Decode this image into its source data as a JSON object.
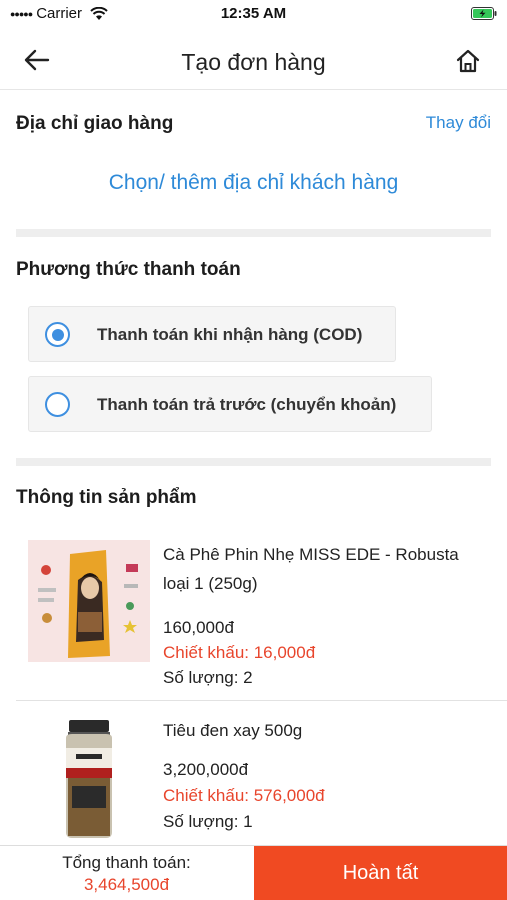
{
  "status_bar": {
    "carrier": "Carrier",
    "time": "12:35 AM"
  },
  "nav": {
    "title": "Tạo đơn hàng",
    "icons": {
      "back": "arrow-left-icon",
      "home": "home-icon"
    }
  },
  "address": {
    "title": "Địa chỉ giao hàng",
    "change_label": "Thay đổi",
    "choose_label": "Chọn/ thêm địa chỉ khách hàng"
  },
  "payment": {
    "title": "Phương thức thanh toán",
    "options": [
      {
        "label": "Thanh toán khi nhận hàng (COD)",
        "selected": true
      },
      {
        "label": "Thanh toán trả trước (chuyển khoản)",
        "selected": false
      }
    ]
  },
  "products": {
    "title": "Thông tin sản phẩm",
    "items": [
      {
        "name": "Cà Phê Phin Nhẹ MISS EDE - Robusta loại 1 (250g)",
        "price": "160,000đ",
        "discount": "Chiết khấu: 16,000đ",
        "quantity": "Số lượng: 2"
      },
      {
        "name": "Tiêu đen xay 500g",
        "price": "3,200,000đ",
        "discount": "Chiết khấu: 576,000đ",
        "quantity": "Số lượng: 1"
      }
    ]
  },
  "footer": {
    "total_label": "Tổng thanh toán:",
    "total_value": "3,464,500đ",
    "complete_label": "Hoàn tất"
  },
  "colors": {
    "accent_blue": "#2e8ad8",
    "accent_red": "#e8452c",
    "button_red": "#f04a22"
  }
}
